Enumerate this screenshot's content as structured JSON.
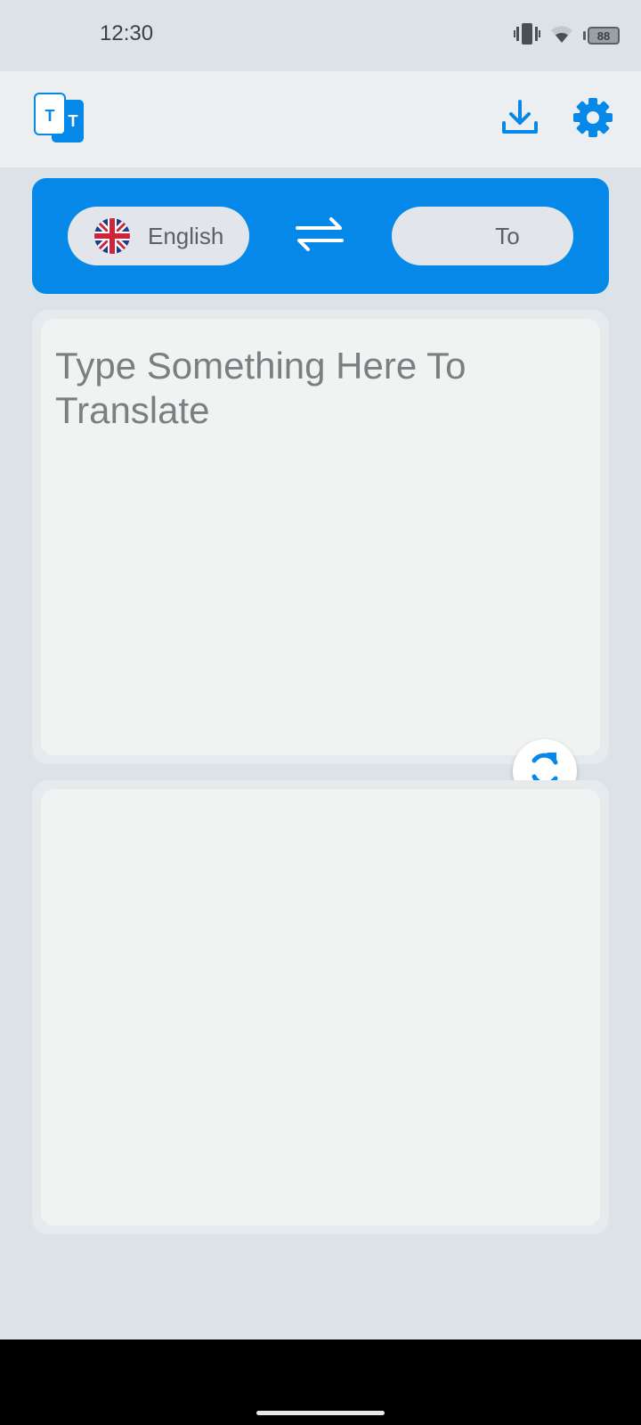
{
  "status_bar": {
    "time": "12:30",
    "battery_level": "88",
    "icons": [
      "vibrate-icon",
      "wifi-icon",
      "battery-icon"
    ]
  },
  "app_bar": {
    "logo_icon": "translate-logo-icon",
    "logo_letters": [
      "T",
      "T"
    ],
    "actions": [
      "download-icon",
      "gear-icon"
    ]
  },
  "language_panel": {
    "from_language": "English",
    "from_flag": "uk-flag-icon",
    "to_language": "To",
    "swap_icon": "swap-arrows-icon"
  },
  "input": {
    "placeholder": "Type Something Here To Translate"
  },
  "output": {
    "text": ""
  },
  "colors": {
    "accent": "#0588e8",
    "background": "#dbe2e8",
    "app_bar": "#eceff1",
    "card": "#f1f3f3"
  }
}
